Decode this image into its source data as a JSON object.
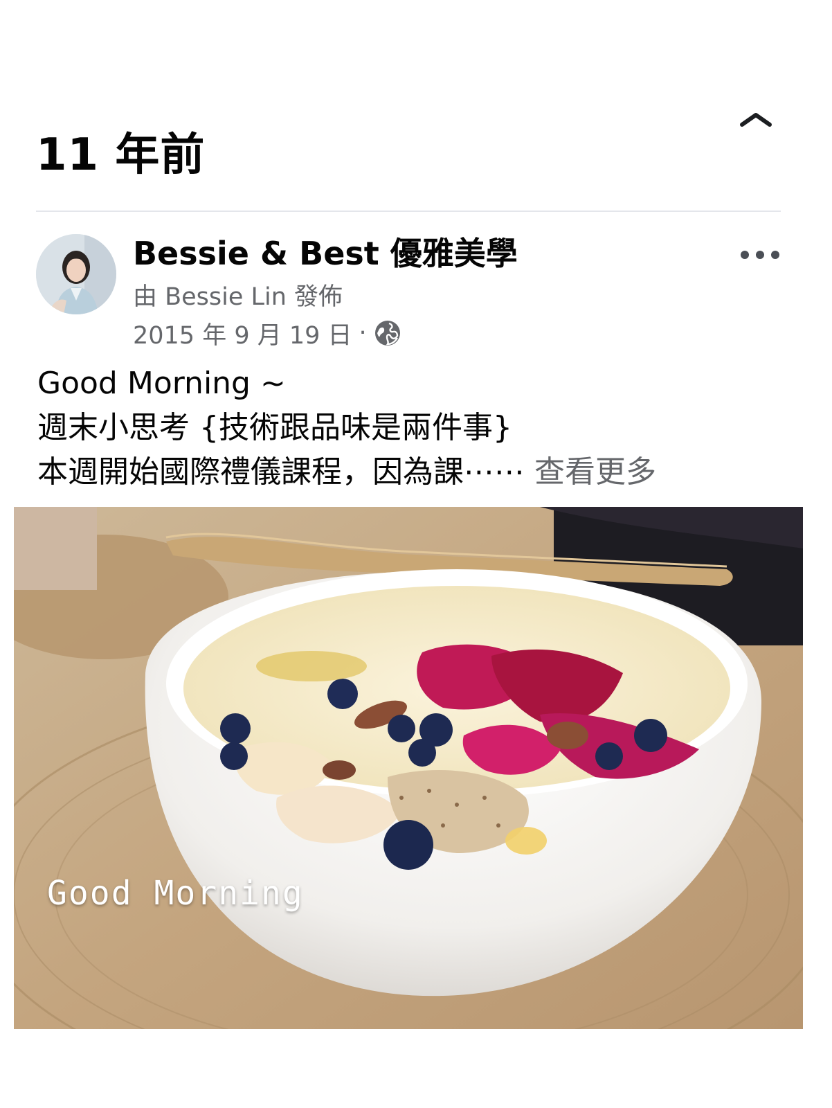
{
  "memory": {
    "title": "11 年前"
  },
  "post": {
    "page_name": "Bessie & Best 優雅美學",
    "posted_by": "由 Bessie Lin 發佈",
    "date": "2015 年 9 月 19 日",
    "separator": "·",
    "lines": [
      "Good Morning ~",
      "週末小思考 {技術跟品味是兩件事}",
      "本週開始國際禮儀課程，因為課⋯⋯ "
    ],
    "see_more": "查看更多",
    "photo_caption": "Good Morning"
  },
  "icons": {
    "collapse": "chevron-up-icon",
    "more": "more-dots-icon",
    "audience": "globe-icon"
  },
  "colors": {
    "text_primary": "#050505",
    "text_secondary": "#65676b",
    "divider": "#e4e6eb"
  }
}
